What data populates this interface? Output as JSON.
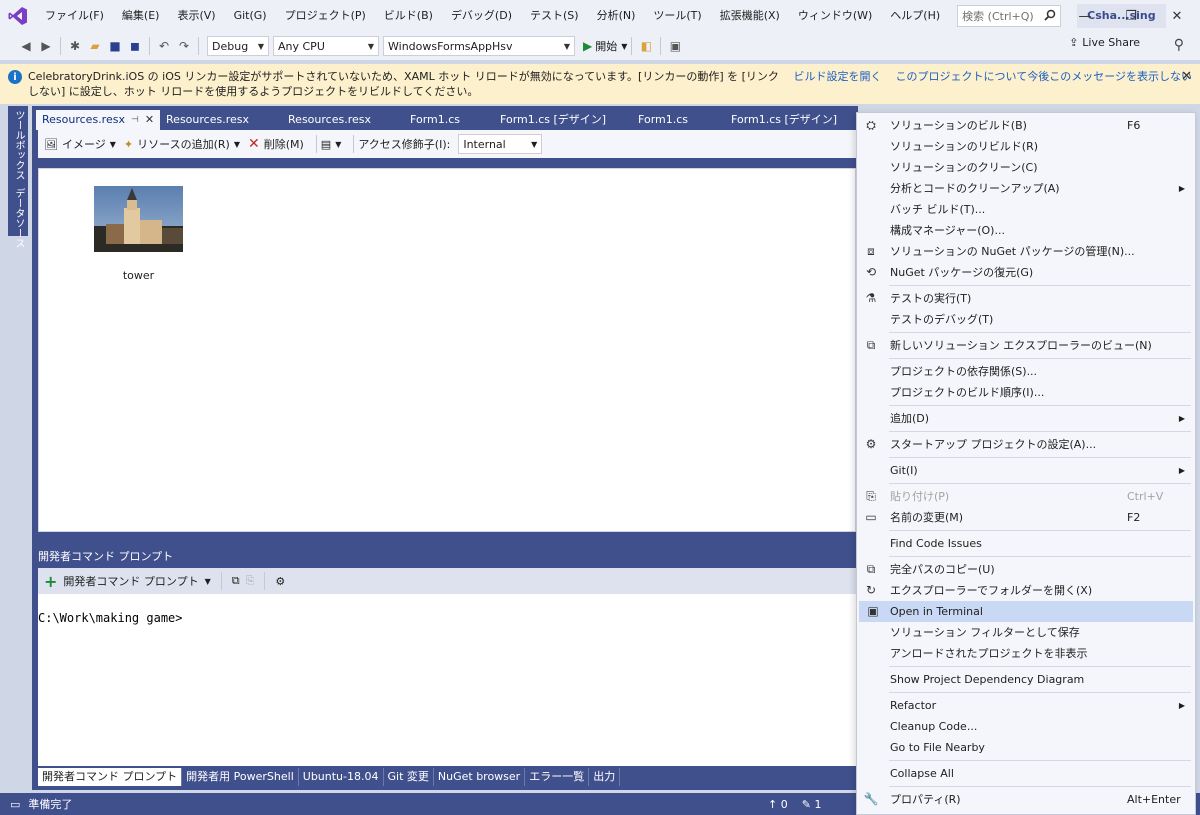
{
  "menu": [
    "ファイル(F)",
    "編集(E)",
    "表示(V)",
    "Git(G)",
    "プロジェクト(P)",
    "ビルド(B)",
    "デバッグ(D)",
    "テスト(S)",
    "分析(N)",
    "ツール(T)",
    "拡張機能(X)",
    "ウィンドウ(W)",
    "ヘルプ(H)"
  ],
  "search": {
    "placeholder": "検索 (Ctrl+Q)"
  },
  "solution_name": "Csha...sing",
  "toolbar": {
    "config": "Debug",
    "platform": "Any CPU",
    "startup_project": "WindowsFormsAppHsv",
    "start_label": "開始",
    "live_share": "Live Share"
  },
  "infobar": {
    "message": "CelebratoryDrink.iOS の iOS リンカー設定がサポートされていないため、XAML ホット リロードが無効になっています。[リンカーの動作] を [リンクしない] に設定し、ホット リロードを使用するようプロジェクトをリビルドしてください。",
    "link1": "ビルド設定を開く",
    "link2": "このプロジェクトについて今後このメッセージを表示しない"
  },
  "side_tabs": [
    "ツールボックス",
    "データソース"
  ],
  "doc_tabs": [
    "Resources.resx",
    "Resources.resx",
    "Resources.resx",
    "Form1.cs",
    "Form1.cs [デザイン]",
    "Form1.cs",
    "Form1.cs [デザイン]"
  ],
  "editor_toolbar": {
    "image": "イメージ",
    "add_resource": "リソースの追加(R)",
    "delete": "削除(M)",
    "access_modifier_label": "アクセス修飾子(I):",
    "access_modifier_value": "Internal"
  },
  "resource": {
    "name": "tower"
  },
  "bottom_panel": {
    "title": "開発者コマンド プロンプト",
    "new_terminal": "開発者コマンド プロンプト",
    "prompt": "C:\\Work\\making game>",
    "tabs": [
      "開発者コマンド プロンプト",
      "開発者用 PowerShell",
      "Ubuntu-18.04",
      "Git 変更",
      "NuGet browser",
      "エラー一覧",
      "出力"
    ]
  },
  "status": {
    "ready": "準備完了",
    "up_count": "0",
    "edit_count": "1"
  },
  "context_menu": [
    {
      "label": "ソリューションのビルド(B)",
      "shortcut": "F6",
      "icon": "build-icon"
    },
    {
      "label": "ソリューションのリビルド(R)"
    },
    {
      "label": "ソリューションのクリーン(C)"
    },
    {
      "label": "分析とコードのクリーンアップ(A)",
      "submenu": true
    },
    {
      "label": "バッチ ビルド(T)..."
    },
    {
      "label": "構成マネージャー(O)..."
    },
    {
      "label": "ソリューションの NuGet パッケージの管理(N)...",
      "icon": "nuget-icon"
    },
    {
      "label": "NuGet パッケージの復元(G)",
      "icon": "restore-icon"
    },
    {
      "sep": true
    },
    {
      "label": "テストの実行(T)",
      "icon": "test-icon"
    },
    {
      "label": "テストのデバッグ(T)"
    },
    {
      "sep": true
    },
    {
      "label": "新しいソリューション エクスプローラーのビュー(N)",
      "icon": "new-view-icon"
    },
    {
      "sep": true
    },
    {
      "label": "プロジェクトの依存関係(S)..."
    },
    {
      "label": "プロジェクトのビルド順序(I)..."
    },
    {
      "sep": true
    },
    {
      "label": "追加(D)",
      "submenu": true
    },
    {
      "sep": true
    },
    {
      "label": "スタートアップ プロジェクトの設定(A)...",
      "icon": "gear-icon"
    },
    {
      "sep": true
    },
    {
      "label": "Git(I)",
      "submenu": true
    },
    {
      "sep": true
    },
    {
      "label": "貼り付け(P)",
      "shortcut": "Ctrl+V",
      "icon": "paste-icon",
      "disabled": true
    },
    {
      "label": "名前の変更(M)",
      "shortcut": "F2",
      "icon": "rename-icon"
    },
    {
      "sep": true
    },
    {
      "label": "Find Code Issues"
    },
    {
      "sep": true
    },
    {
      "label": "完全パスのコピー(U)",
      "icon": "copy-icon"
    },
    {
      "label": "エクスプローラーでフォルダーを開く(X)",
      "icon": "open-folder-icon"
    },
    {
      "label": "Open in Terminal",
      "icon": "terminal-icon",
      "highlight": true
    },
    {
      "label": "ソリューション フィルターとして保存"
    },
    {
      "label": "アンロードされたプロジェクトを非表示"
    },
    {
      "sep": true
    },
    {
      "label": "Show Project Dependency Diagram"
    },
    {
      "sep": true
    },
    {
      "label": "Refactor",
      "submenu": true
    },
    {
      "label": "Cleanup Code..."
    },
    {
      "label": "Go to File Nearby"
    },
    {
      "sep": true
    },
    {
      "label": "Collapse All"
    },
    {
      "sep": true
    },
    {
      "label": "プロパティ(R)",
      "shortcut": "Alt+Enter",
      "icon": "wrench-icon"
    }
  ]
}
